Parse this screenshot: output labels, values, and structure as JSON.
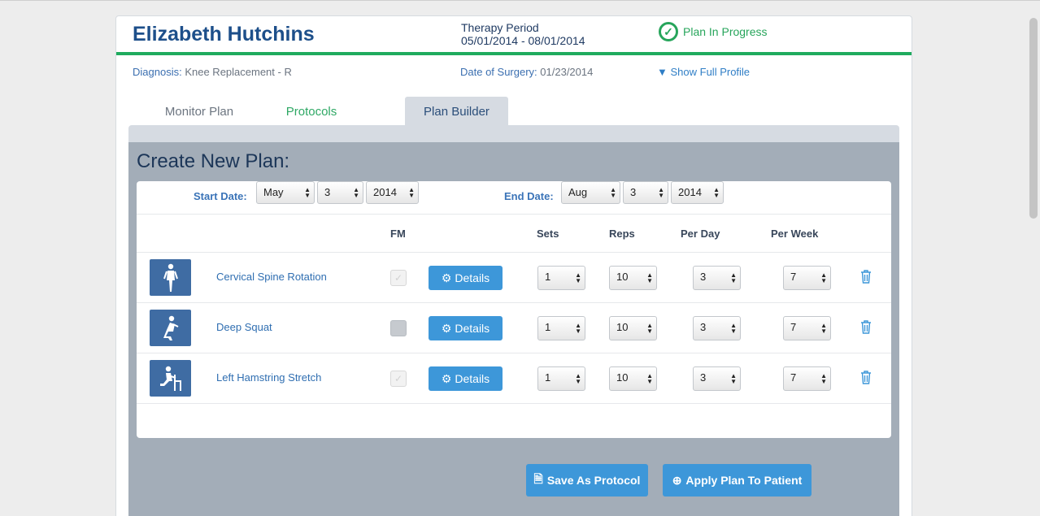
{
  "patient": {
    "name": "Elizabeth Hutchins",
    "therapy_label": "Therapy Period",
    "therapy_dates": "05/01/2014 - 08/01/2014",
    "status": "Plan In Progress",
    "diagnosis_label": "Diagnosis:",
    "diagnosis_value": "Knee Replacement - R",
    "surgery_label": "Date of Surgery:",
    "surgery_value": "01/23/2014",
    "show_profile": "Show Full Profile"
  },
  "tabs": {
    "monitor": "Monitor Plan",
    "protocols": "Protocols",
    "builder": "Plan Builder"
  },
  "builder": {
    "title": "Create New Plan:",
    "start_label": "Start Date:",
    "start": {
      "month": "May",
      "day": "3",
      "year": "2014"
    },
    "end_label": "End Date:",
    "end": {
      "month": "Aug",
      "day": "3",
      "year": "2014"
    },
    "columns": {
      "fm": "FM",
      "sets": "Sets",
      "reps": "Reps",
      "per_day": "Per Day",
      "per_week": "Per Week"
    },
    "details_label": "Details",
    "exercises": [
      {
        "name": "Cervical Spine Rotation",
        "fm": "checked",
        "sets": "1",
        "reps": "10",
        "per_day": "3",
        "per_week": "7",
        "icon": "standing-figure-icon"
      },
      {
        "name": "Deep Squat",
        "fm": "unchecked",
        "sets": "1",
        "reps": "10",
        "per_day": "3",
        "per_week": "7",
        "icon": "squat-figure-icon"
      },
      {
        "name": "Left Hamstring Stretch",
        "fm": "checked",
        "sets": "1",
        "reps": "10",
        "per_day": "3",
        "per_week": "7",
        "icon": "seated-stretch-figure-icon"
      }
    ],
    "save_protocol": "Save As Protocol",
    "apply_plan": "Apply Plan To Patient"
  },
  "colors": {
    "accent_blue": "#3d97d9",
    "status_green": "#27a55b",
    "name_blue": "#1d4f8a"
  }
}
